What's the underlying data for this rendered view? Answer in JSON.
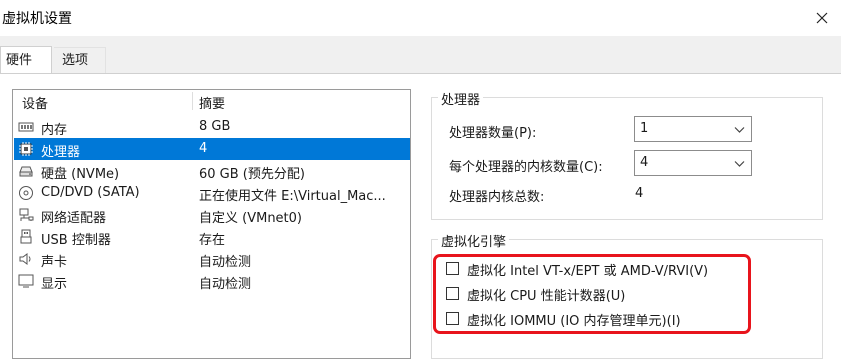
{
  "window": {
    "title": "虚拟机设置"
  },
  "tabs": [
    {
      "label": "硬件",
      "active": true
    },
    {
      "label": "选项",
      "active": false
    }
  ],
  "device_list": {
    "col_device": "设备",
    "col_summary": "摘要",
    "rows": [
      {
        "icon": "memory-icon",
        "name": "内存",
        "value": "8 GB",
        "selected": false
      },
      {
        "icon": "processor-icon",
        "name": "处理器",
        "value": "4",
        "selected": true
      },
      {
        "icon": "hard-disk-icon",
        "name": "硬盘 (NVMe)",
        "value": "60 GB (预先分配)",
        "selected": false
      },
      {
        "icon": "cd-dvd-icon",
        "name": "CD/DVD (SATA)",
        "value": "正在使用文件 E:\\Virtual_Mac...",
        "selected": false
      },
      {
        "icon": "network-adapter-icon",
        "name": "网络适配器",
        "value": "自定义 (VMnet0)",
        "selected": false
      },
      {
        "icon": "usb-icon",
        "name": "USB 控制器",
        "value": "存在",
        "selected": false
      },
      {
        "icon": "sound-card-icon",
        "name": "声卡",
        "value": "自动检测",
        "selected": false
      },
      {
        "icon": "display-icon",
        "name": "显示",
        "value": "自动检测",
        "selected": false
      }
    ]
  },
  "processors": {
    "group_title": "处理器",
    "count_label": "处理器数量(P):",
    "count_value": "1",
    "cores_label": "每个处理器的内核数量(C):",
    "cores_value": "4",
    "total_label": "处理器内核总数:",
    "total_value": "4"
  },
  "virtualization": {
    "group_title": "虚拟化引擎",
    "options": [
      {
        "label": "虚拟化 Intel VT-x/EPT 或 AMD-V/RVI(V)",
        "checked": false
      },
      {
        "label": "虚拟化 CPU 性能计数器(U)",
        "checked": false
      },
      {
        "label": "虚拟化 IOMMU (IO 内存管理单元)(I)",
        "checked": false
      }
    ]
  },
  "colors": {
    "selection": "#0078d7",
    "highlight_box": "#e8141c"
  }
}
